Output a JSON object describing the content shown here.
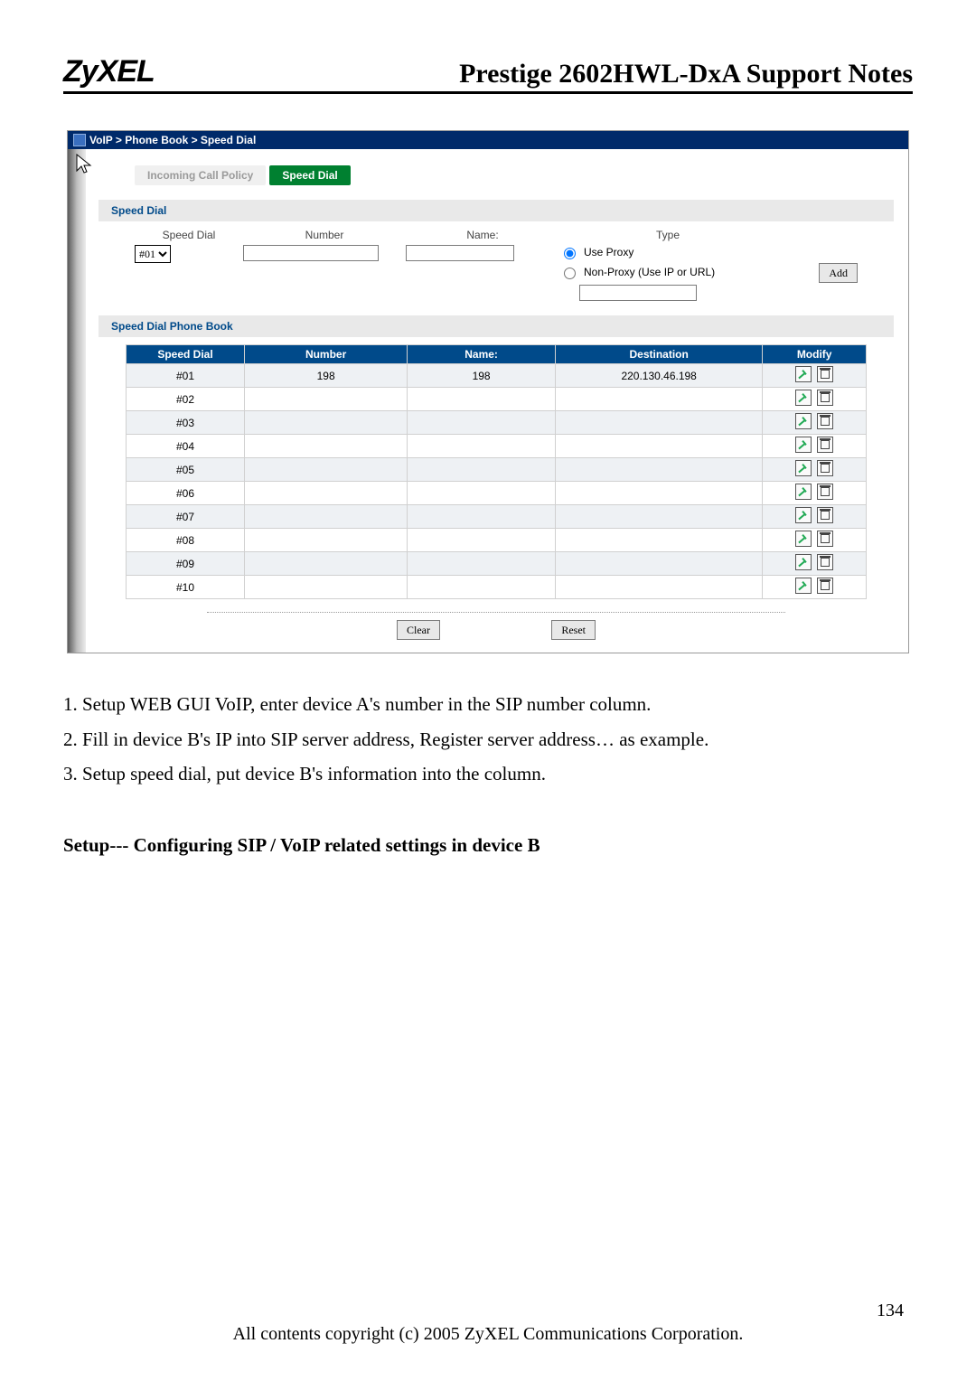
{
  "header": {
    "logo": "ZyXEL",
    "title": "Prestige 2602HWL-DxA Support Notes"
  },
  "breadcrumb": "VoIP > Phone Book > Speed Dial",
  "tabs": {
    "inactive": "Incoming Call Policy",
    "active": "Speed Dial"
  },
  "section1": {
    "title": "Speed Dial",
    "labels": {
      "speed_dial": "Speed Dial",
      "number": "Number",
      "name": "Name:",
      "type": "Type"
    },
    "select_value": "#01",
    "radio_use_proxy": "Use Proxy",
    "radio_non_proxy": "Non-Proxy (Use IP or URL)",
    "add_btn": "Add"
  },
  "section2": {
    "title": "Speed Dial Phone Book",
    "columns": [
      "Speed Dial",
      "Number",
      "Name:",
      "Destination",
      "Modify"
    ],
    "rows": [
      {
        "sd": "#01",
        "num": "198",
        "name": "198",
        "dest": "220.130.46.198"
      },
      {
        "sd": "#02",
        "num": "",
        "name": "",
        "dest": ""
      },
      {
        "sd": "#03",
        "num": "",
        "name": "",
        "dest": ""
      },
      {
        "sd": "#04",
        "num": "",
        "name": "",
        "dest": ""
      },
      {
        "sd": "#05",
        "num": "",
        "name": "",
        "dest": ""
      },
      {
        "sd": "#06",
        "num": "",
        "name": "",
        "dest": ""
      },
      {
        "sd": "#07",
        "num": "",
        "name": "",
        "dest": ""
      },
      {
        "sd": "#08",
        "num": "",
        "name": "",
        "dest": ""
      },
      {
        "sd": "#09",
        "num": "",
        "name": "",
        "dest": ""
      },
      {
        "sd": "#10",
        "num": "",
        "name": "",
        "dest": ""
      }
    ],
    "clear_btn": "Clear",
    "reset_btn": "Reset"
  },
  "body_lines": [
    "1. Setup WEB GUI VoIP, enter device A's number in the SIP number column.",
    "2. Fill in device B's IP into SIP server address, Register server address… as example.",
    "3. Setup speed dial, put device B's information into the column."
  ],
  "subhead": "Setup--- Configuring SIP / VoIP related settings in device B",
  "page_number": "134",
  "footer": "All contents copyright (c) 2005 ZyXEL Communications Corporation."
}
